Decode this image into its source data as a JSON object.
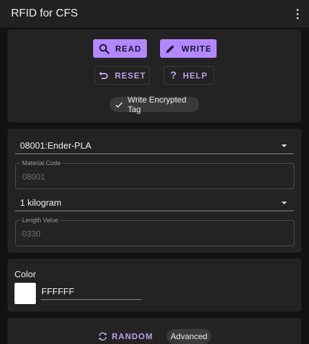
{
  "app": {
    "title": "RFID for CFS"
  },
  "actions": {
    "read_label": "READ",
    "write_label": "WRITE",
    "reset_label": "RESET",
    "help_label": "HELP",
    "encrypted_chip": {
      "label": "Write Encrypted Tag",
      "checked": true
    }
  },
  "filament": {
    "selected": "08001:Ender-PLA",
    "material_code": {
      "label": "Material Code",
      "value": "08001"
    },
    "weight_selected": "1 kilogram",
    "length": {
      "label": "Length Value",
      "value": "0330"
    }
  },
  "color": {
    "label": "Color",
    "hex": "FFFFFF",
    "swatch": "#FFFFFF"
  },
  "bottom": {
    "random_label": "RANDOM",
    "advanced_label": "Advanced"
  },
  "theme": {
    "accent": "#b388ff",
    "background": "#121212",
    "card": "#232323"
  },
  "icons": {
    "read": "search-icon",
    "write": "pencil-icon",
    "reset": "undo-icon",
    "help": "question-icon",
    "chip": "check-icon",
    "random": "refresh-icon",
    "overflow": "more-vertical-icon"
  }
}
